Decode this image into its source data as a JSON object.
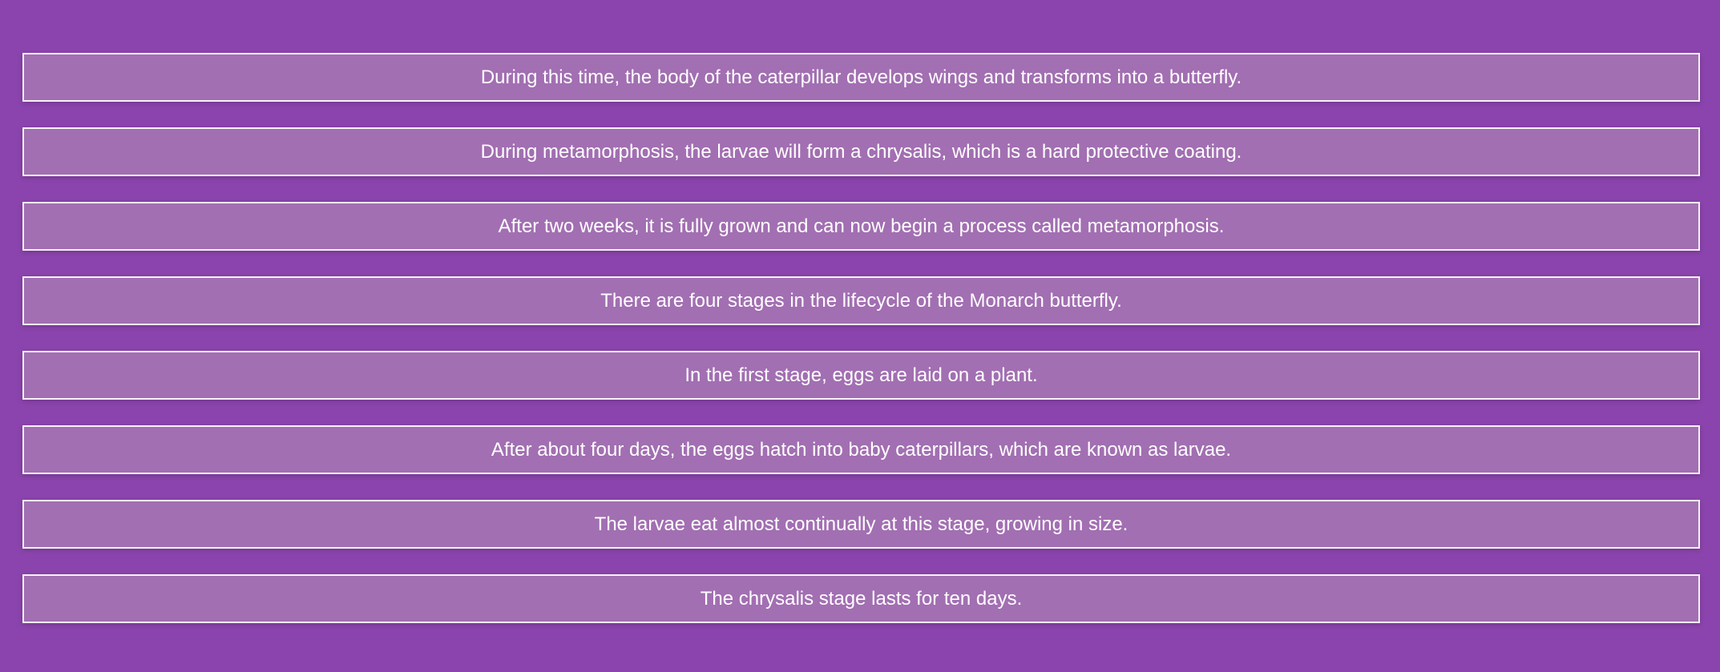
{
  "cards": [
    "During this time, the body of the caterpillar develops wings and transforms into a butterfly.",
    "During metamorphosis, the larvae will form a chrysalis, which is a hard protective coating.",
    "After two weeks, it is fully grown and can now begin a process called metamorphosis.",
    "There are four stages in the lifecycle of the Monarch butterfly.",
    "In the first stage, eggs are laid on a plant.",
    "After about four days, the eggs hatch into baby caterpillars, which are known as larvae.",
    "The larvae eat almost continually at this stage, growing in size.",
    "The chrysalis stage lasts for ten days."
  ],
  "colors": {
    "background": "#8b44ad",
    "card_border": "#ffffff",
    "text": "#ffffff"
  }
}
